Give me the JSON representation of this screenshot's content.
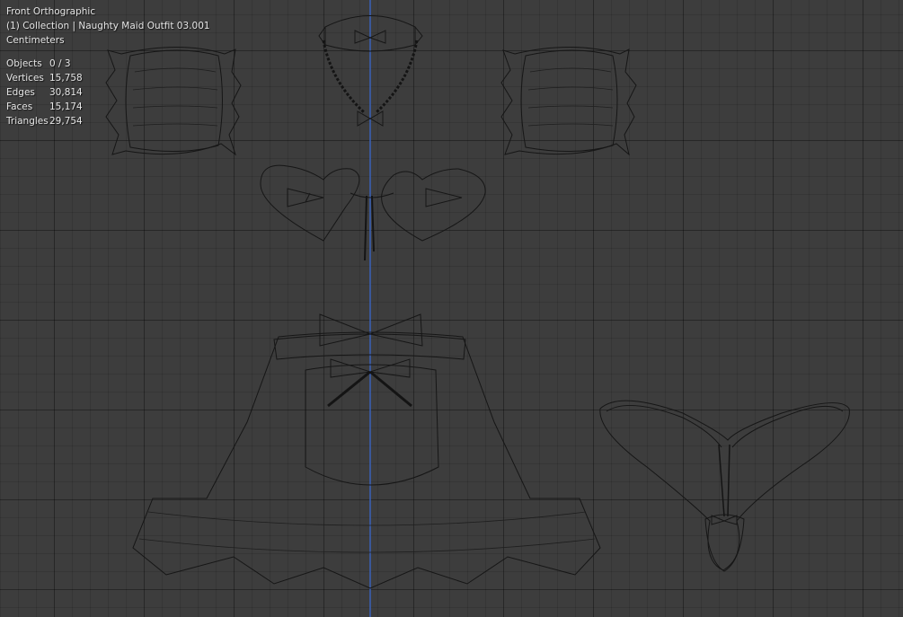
{
  "viewport": {
    "view_name": "Front Orthographic",
    "collection_info": "(1) Collection | Naughty Maid Outfit 03.001",
    "units": "Centimeters",
    "axis_color": "#3a62b8"
  },
  "stats": [
    {
      "label": "Objects",
      "value": "0 / 3"
    },
    {
      "label": "Vertices",
      "value": "15,758"
    },
    {
      "label": "Edges",
      "value": "30,814"
    },
    {
      "label": "Faces",
      "value": "15,174"
    },
    {
      "label": "Triangles",
      "value": "29,754"
    }
  ]
}
